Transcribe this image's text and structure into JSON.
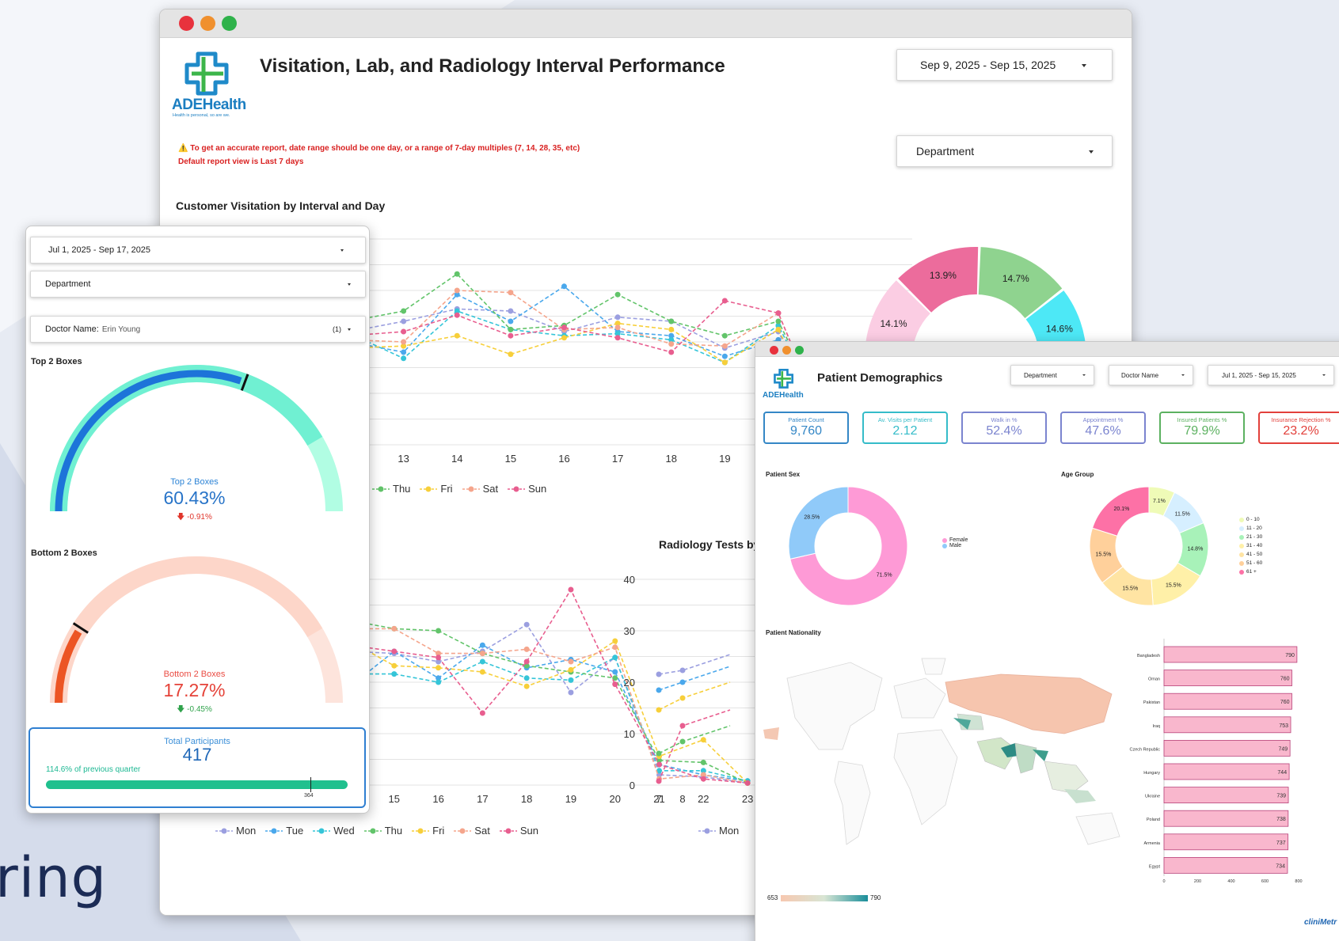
{
  "tagline": "ring",
  "main": {
    "title": "Visitation, Lab, and Radiology Interval Performance",
    "date_range": "Sep 9, 2025 - Sep 15, 2025",
    "department": "Department",
    "warning": "⚠️ To get an accurate report, date range should be one day, or a range of 7-day multiples (7, 14, 28, 35, etc)",
    "warning2": "Default report view is Last 7 days",
    "visit_chart_title": "Customer Visitation by Interval and Day",
    "radiology_title": "Radiology Tests by",
    "logo_text": "ADEHealth",
    "logo_sub": "Health is personal, so are we.",
    "legend_days": [
      "Mon",
      "Tue",
      "Wed",
      "Thu",
      "Fri",
      "Sat",
      "Sun"
    ],
    "legend_top_partial": [
      "Thu",
      "Fri",
      "Sat",
      "Sun"
    ],
    "radiology_legend_partial": [
      "Mon"
    ],
    "radiology_yticks": [
      "40",
      "30",
      "20",
      "10",
      "0"
    ],
    "radiology_xticks": [
      "7",
      "8"
    ],
    "colors": {
      "Mon": "#9b9fe0",
      "Tue": "#4aa8ec",
      "Wed": "#35c5d8",
      "Thu": "#62c46a",
      "Fri": "#f7cf3a",
      "Sat": "#f5a58c",
      "Sun": "#e85e8f"
    }
  },
  "donut": {
    "labels": [
      "14.1%",
      "13.9%",
      "14.7%",
      "14.6%"
    ],
    "colors": [
      "#fbcde3",
      "#ec6c9c",
      "#8fd38f",
      "#4de8f6"
    ]
  },
  "survey": {
    "date_range": "Jul 1, 2025 - Sep 17, 2025",
    "department": "Department",
    "doctor_label": "Doctor Name:",
    "doctor_value": "Erin Young",
    "doctor_count": "(1)",
    "top_title": "Top 2 Boxes",
    "top_label": "Top 2 Boxes",
    "top_value": "60.43%",
    "top_value_frac": 0.6043,
    "top_delta": "🡇 -0.91%",
    "bottom_title": "Bottom 2 Boxes",
    "bottom_label": "Bottom 2 Boxes",
    "bottom_value": "17.27%",
    "bottom_value_frac": 0.1727,
    "bottom_delta": "🡇 -0.45%",
    "total_label": "Total Participants",
    "total_value": "417",
    "total_sub": "114.6% of previous quarter",
    "target": "364"
  },
  "demo": {
    "title": "Patient Demographics",
    "filters": [
      "Department",
      "Doctor Name",
      "Jul 1, 2025 - Sep 15, 2025"
    ],
    "kpis": [
      {
        "label": "Patient Count",
        "value": "9,760",
        "color": "#3487c6"
      },
      {
        "label": "Av. Visits per Patient",
        "value": "2.12",
        "color": "#35bcc9"
      },
      {
        "label": "Walk in %",
        "value": "52.4%",
        "color": "#7b84cf"
      },
      {
        "label": "Appointment %",
        "value": "47.6%",
        "color": "#7b84cf"
      },
      {
        "label": "Insured Patients %",
        "value": "79.9%",
        "color": "#5cb160"
      },
      {
        "label": "Insurance Rejection %",
        "value": "23.2%",
        "color": "#e2403b"
      }
    ],
    "sex_title": "Patient Sex",
    "sex": [
      {
        "label": "Female",
        "value": "71.5%",
        "color": "#fe9ad6"
      },
      {
        "label": "Male",
        "value": "28.5%",
        "color": "#90caf9"
      }
    ],
    "age_title": "Age Group",
    "age": [
      {
        "label": "0 - 10",
        "value": "7.1%",
        "color": "#effbb7"
      },
      {
        "label": "11 - 20",
        "value": "11.5%",
        "color": "#d6efff"
      },
      {
        "label": "21 - 30",
        "value": "14.8%",
        "color": "#a8f2b9"
      },
      {
        "label": "31 - 40",
        "value": "15.5%",
        "color": "#fff0a8"
      },
      {
        "label": "41 - 50",
        "value": "15.5%",
        "color": "#ffe4a3"
      },
      {
        "label": "51 - 60",
        "value": "15.5%",
        "color": "#ffd09b"
      },
      {
        "label": "61 +",
        "value": "20.1%",
        "color": "#fd71a6"
      }
    ],
    "nat_title": "Patient Nationality",
    "scale_min": "653",
    "scale_max": "790",
    "nationality": {
      "countries": [
        "Bangladesh",
        "Oman",
        "Pakistan",
        "Iraq",
        "Czech Republic",
        "Hungary",
        "Ukraine",
        "Poland",
        "Armenia",
        "Egypt"
      ],
      "values": [
        790,
        760,
        760,
        753,
        749,
        744,
        739,
        738,
        737,
        734
      ],
      "xticks": [
        "0",
        "200",
        "400",
        "600",
        "800"
      ],
      "xmax": 800
    },
    "brand": "cliniMetr"
  }
}
